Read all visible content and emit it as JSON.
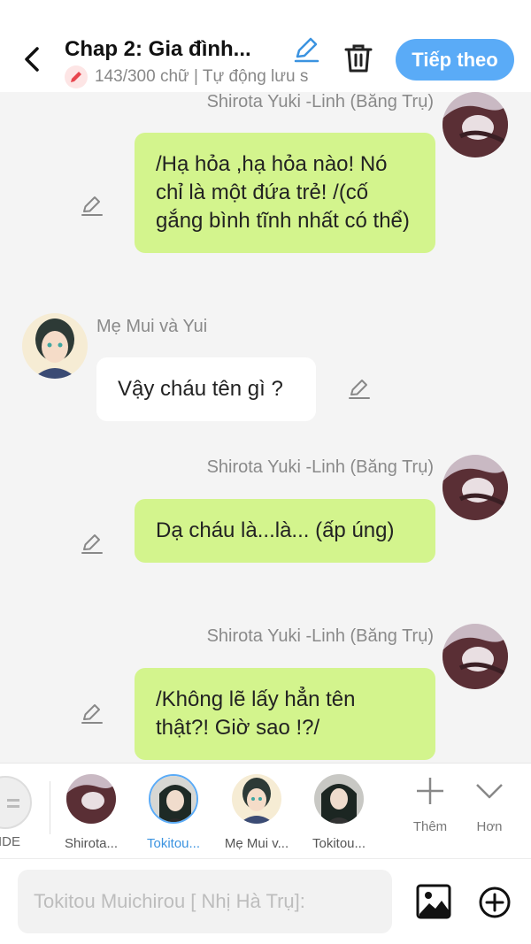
{
  "header": {
    "title": "Chap 2: Gia đình...",
    "subtitle": "143/300 chữ | Tự động lưu s",
    "next_label": "Tiếp theo"
  },
  "messages": [
    {
      "name": "Shirota Yuki -Linh (Băng Trụ)",
      "text": "/Hạ hỏa ,hạ hỏa nào! Nó chỉ là một đứa trẻ! /(cố gắng bình tĩnh nhất có thể)"
    },
    {
      "name": "Mẹ Mui và Yui",
      "text": "Vậy cháu tên gì ?"
    },
    {
      "name": "Shirota Yuki -Linh (Băng Trụ)",
      "text": "Dạ cháu là...là... (ấp úng)"
    },
    {
      "name": "Shirota Yuki -Linh (Băng Trụ)",
      "text": "/Không lẽ lấy hẳn tên thật?!  Giờ sao !?/"
    }
  ],
  "characters": {
    "side_label": "IDE",
    "items": [
      {
        "label": "Shirota..."
      },
      {
        "label": "Tokitou..."
      },
      {
        "label": "Mẹ Mui v..."
      },
      {
        "label": "Tokitou..."
      }
    ],
    "add_label": "Thêm",
    "more_label": "Hơn"
  },
  "input": {
    "placeholder": "Tokitou Muichirou [ Nhị Hà Trụ]:"
  },
  "colors": {
    "accent": "#5aabf7",
    "bubble_right": "#d3f48d",
    "bubble_left": "#ffffff",
    "background": "#f4f4f4"
  }
}
